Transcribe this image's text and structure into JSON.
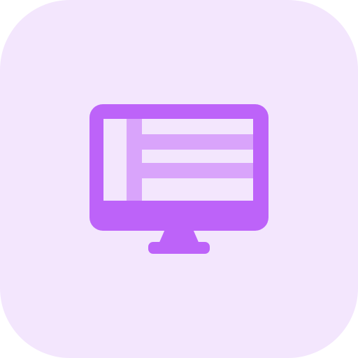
{
  "icon": {
    "name": "desktop-monitor-icon",
    "colors": {
      "background": "#f3e6fd",
      "primary": "#bd63f9",
      "secondary": "#d9a4fb",
      "screen": "#f3e6fd"
    }
  }
}
